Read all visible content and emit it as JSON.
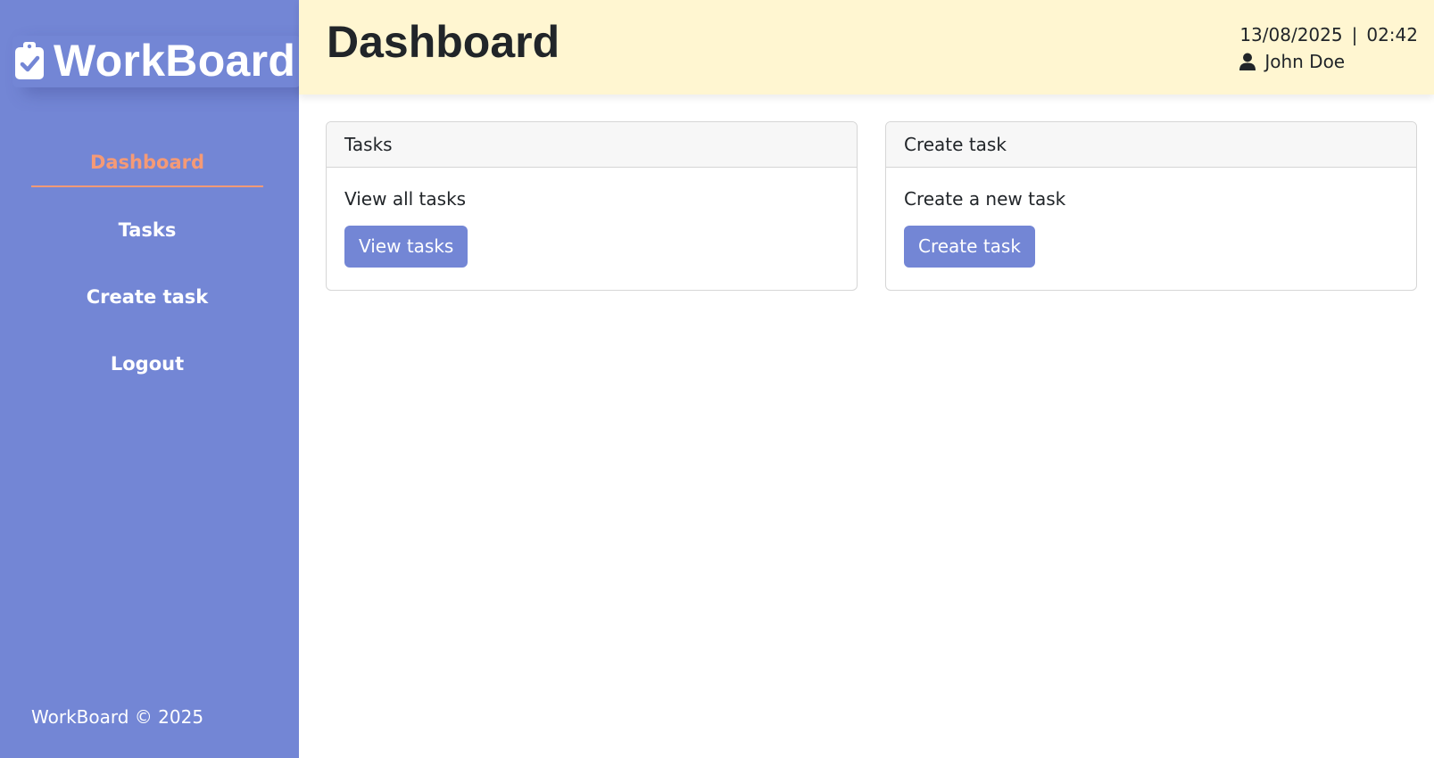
{
  "sidebar": {
    "brand": "WorkBoard",
    "brand_icon": "clipboard-check-icon",
    "items": [
      {
        "label": "Dashboard",
        "active": true
      },
      {
        "label": "Tasks",
        "active": false
      },
      {
        "label": "Create task",
        "active": false
      },
      {
        "label": "Logout",
        "active": false
      }
    ],
    "footer": "WorkBoard © 2025"
  },
  "header": {
    "title": "Dashboard",
    "date": "13/08/2025",
    "separator": "|",
    "time": "02:42",
    "user_icon": "user-icon",
    "user_name": "John Doe"
  },
  "cards": [
    {
      "header": "Tasks",
      "text": "View all tasks",
      "button": "View tasks"
    },
    {
      "header": "Create task",
      "text": "Create a new task",
      "button": "Create task"
    }
  ],
  "colors": {
    "sidebar_bg": "#7386d5",
    "active_accent": "#f59a76",
    "topbar_bg": "#fff6d1",
    "button_bg": "#7386d5"
  }
}
